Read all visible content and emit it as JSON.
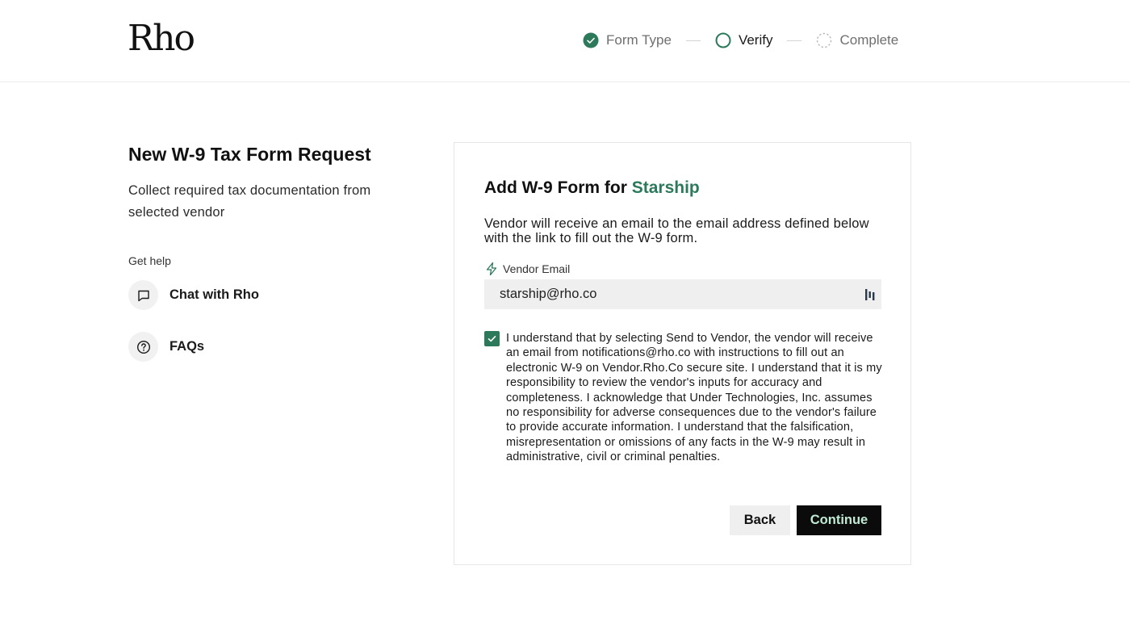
{
  "header": {
    "logo_text": "Rho",
    "steps": [
      {
        "label": "Form Type",
        "status": "done"
      },
      {
        "label": "Verify",
        "status": "active"
      },
      {
        "label": "Complete",
        "status": "pending"
      }
    ]
  },
  "left": {
    "title": "New W-9 Tax Form Request",
    "subtitle": "Collect required tax documentation from selected vendor",
    "help_heading": "Get help",
    "help_items": [
      {
        "label": "Chat with Rho",
        "icon": "chat-icon"
      },
      {
        "label": "FAQs",
        "icon": "question-circle-icon"
      }
    ]
  },
  "card": {
    "title_prefix": "Add W-9 Form for ",
    "vendor_name": "Starship",
    "description": "Vendor will receive an email to the email address defined below with the link to fill out the W-9 form.",
    "email_label": "Vendor Email",
    "email_value": "starship@rho.co",
    "consent_checked": true,
    "consent_text": "I understand that by selecting Send to Vendor, the vendor will receive an email from notifications@rho.co with instructions to fill out an electronic W-9 on Vendor.Rho.Co secure site. I understand that it is my responsibility to review the vendor's inputs for accuracy and completeness. I acknowledge that Under Technologies, Inc. assumes no responsibility for adverse consequences due to the vendor's failure to provide accurate information. I understand that the falsification, misrepresentation or omissions of any facts in the W-9 may result in administrative, civil or criminal penalties.",
    "back_label": "Back",
    "continue_label": "Continue"
  },
  "colors": {
    "accent": "#2c7a5b",
    "button_dark": "#0b0b0b",
    "button_text_accent": "#bfead4"
  }
}
